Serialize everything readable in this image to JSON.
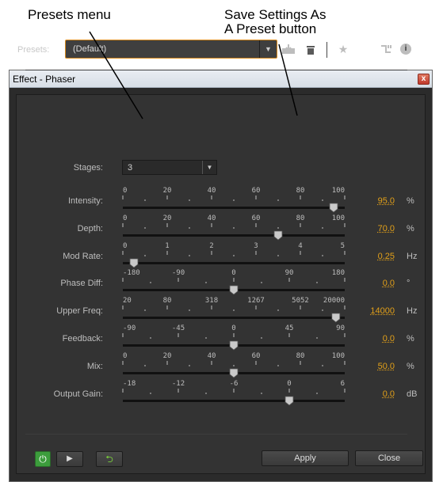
{
  "callouts": {
    "presets_menu": "Presets menu",
    "save_preset_line1": "Save Settings As",
    "save_preset_line2": "A Preset button"
  },
  "window": {
    "title": "Effect - Phaser",
    "close_glyph": "x"
  },
  "presets": {
    "label": "Presets:",
    "value": "(Default)"
  },
  "toolbar_icons": [
    "save-preset-icon",
    "trash-icon",
    "star-icon",
    "routing-icon",
    "info-icon"
  ],
  "stages": {
    "label": "Stages:",
    "value": "3"
  },
  "params": [
    {
      "name": "intensity",
      "label": "Intensity:",
      "ticks": [
        "0",
        "20",
        "40",
        "60",
        "80",
        "100"
      ],
      "position": 0.95,
      "value": "95.0",
      "unit": "%"
    },
    {
      "name": "depth",
      "label": "Depth:",
      "ticks": [
        "0",
        "20",
        "40",
        "60",
        "80",
        "100"
      ],
      "position": 0.7,
      "value": "70.0",
      "unit": "%"
    },
    {
      "name": "mod-rate",
      "label": "Mod Rate:",
      "ticks": [
        "0",
        "1",
        "2",
        "3",
        "4",
        "5"
      ],
      "position": 0.05,
      "value": "0.25",
      "unit": "Hz"
    },
    {
      "name": "phase-diff",
      "label": "Phase Diff:",
      "ticks": [
        "-180",
        "-90",
        "0",
        "90",
        "180"
      ],
      "position": 0.5,
      "value": "0.0",
      "unit": "°"
    },
    {
      "name": "upper-freq",
      "label": "Upper Freq:",
      "ticks": [
        "20",
        "80",
        "318",
        "1267",
        "5052",
        "20000"
      ],
      "position": 0.96,
      "value": "14000",
      "unit": "Hz"
    },
    {
      "name": "feedback",
      "label": "Feedback:",
      "ticks": [
        "-90",
        "-45",
        "0",
        "45",
        "90"
      ],
      "position": 0.5,
      "value": "0.0",
      "unit": "%"
    },
    {
      "name": "mix",
      "label": "Mix:",
      "ticks": [
        "0",
        "20",
        "40",
        "60",
        "80",
        "100"
      ],
      "position": 0.5,
      "value": "50.0",
      "unit": "%"
    },
    {
      "name": "output-gain",
      "label": "Output Gain:",
      "ticks": [
        "-18",
        "-12",
        "-6",
        "0",
        "6"
      ],
      "position": 0.75,
      "value": "0.0",
      "unit": "dB"
    }
  ],
  "footer": {
    "apply_label": "Apply",
    "close_label": "Close"
  },
  "colors": {
    "value_accent": "#e2a019",
    "presets_border": "#d98a1c",
    "power_on": "#3c9d3c"
  }
}
